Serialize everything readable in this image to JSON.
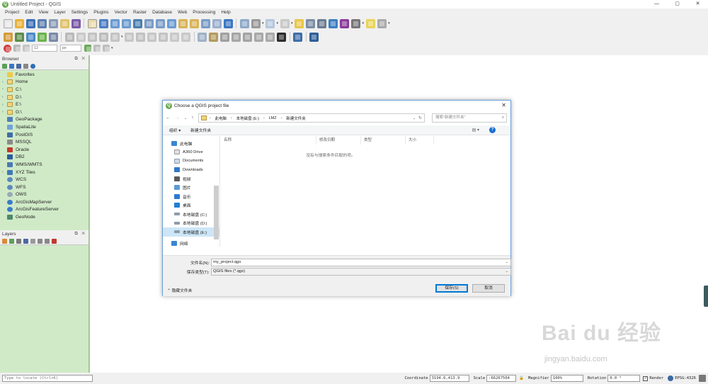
{
  "window": {
    "title": "Untitled Project - QGIS",
    "minimize": "—",
    "maximize": "▢",
    "close": "✕"
  },
  "menu": [
    "Project",
    "Edit",
    "View",
    "Layer",
    "Settings",
    "Plugins",
    "Vector",
    "Raster",
    "Database",
    "Web",
    "Processing",
    "Help"
  ],
  "toolbar3": {
    "size_value": "12",
    "unit_value": "px"
  },
  "browser": {
    "title": "Browser",
    "items": [
      "Favorites",
      "Home",
      "C:\\",
      "D:\\",
      "E:\\",
      "G:\\",
      "GeoPackage",
      "SpatiaLite",
      "PostGIS",
      "MSSQL",
      "Oracle",
      "DB2",
      "WMS/WMTS",
      "XYZ Tiles",
      "WCS",
      "WFS",
      "OWS",
      "ArcGisMapServer",
      "ArcGisFeatureServer",
      "GeoNode"
    ]
  },
  "layers": {
    "title": "Layers"
  },
  "status": {
    "locate_placeholder": "Type to locate (Ctrl+K)",
    "coordinate_label": "Coordinate",
    "coordinate_value": "3194.6,413.9",
    "scale_label": "Scale",
    "scale_value": ":66267564",
    "magnifier_label": "Magnifier",
    "magnifier_value": "100%",
    "rotation_label": "Rotation",
    "rotation_value": "0.0 °",
    "render_label": "Render",
    "crs_label": "EPSG:4326"
  },
  "dialog": {
    "title": "Choose a QGIS project file",
    "breadcrumbs": [
      "此电脑",
      "本地磁盘 (E:)",
      "LMZ",
      "新建文件夹"
    ],
    "search_placeholder": "搜索\"新建文件夹\"",
    "organize": "组织 ▾",
    "new_folder": "新建文件夹",
    "nav_items": [
      {
        "label": "此电脑",
        "icon": "pc-icon"
      },
      {
        "label": "A360 Drive",
        "icon": "cloud-icon"
      },
      {
        "label": "Documents",
        "icon": "documents-icon"
      },
      {
        "label": "Downloads",
        "icon": "download-icon"
      },
      {
        "label": "视频",
        "icon": "video-icon"
      },
      {
        "label": "图片",
        "icon": "picture-icon"
      },
      {
        "label": "音乐",
        "icon": "music-icon"
      },
      {
        "label": "桌面",
        "icon": "desktop-icon"
      },
      {
        "label": "本地磁盘 (C:)",
        "icon": "drive-icon"
      },
      {
        "label": "本地磁盘 (D:)",
        "icon": "drive-icon"
      },
      {
        "label": "本地磁盘 (E:)",
        "icon": "drive-icon"
      },
      {
        "label": "网络",
        "icon": "network-icon"
      }
    ],
    "columns": [
      "名称",
      "修改日期",
      "类型",
      "大小"
    ],
    "empty_message": "没有与搜索条件匹配的项。",
    "filename_label": "文件名(N):",
    "filename_value": "my_project.qgs",
    "filetype_label": "保存类型(T):",
    "filetype_value": "QGIS files (*.qgs)",
    "hide_folders": "隐藏文件夹",
    "save": "保存(S)",
    "cancel": "取消"
  },
  "watermark": {
    "brand": "Bai du 经验",
    "url": "jingyan.baidu.com"
  },
  "colors": {
    "panel_green": "#d0eac7",
    "qgis_green": "#6aa84f",
    "accent_blue": "#0078d7"
  }
}
